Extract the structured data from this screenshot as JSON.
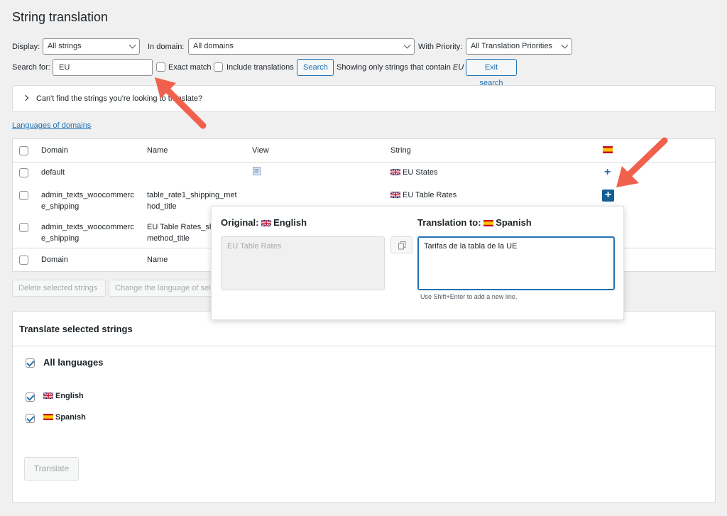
{
  "page": {
    "title": "String translation"
  },
  "filters": {
    "display_label": "Display:",
    "display_value": "All strings",
    "domain_label": "In domain:",
    "domain_value": "All domains",
    "priority_label": "With Priority:",
    "priority_value": "All Translation Priorities",
    "search_label": "Search for:",
    "search_value": "EU",
    "exact_match_label": "Exact match",
    "include_translations_label": "Include translations",
    "search_button": "Search",
    "showing_prefix": "Showing only strings that contain",
    "showing_term": "EU",
    "exit_search_button": "Exit search"
  },
  "notice": {
    "text": "Can't find the strings you're looking to translate?"
  },
  "languages_link": "Languages of domains",
  "table": {
    "headers": {
      "domain": "Domain",
      "name": "Name",
      "view": "View",
      "string": "String"
    },
    "rows": [
      {
        "domain": "default",
        "name": "",
        "string": "EU States"
      },
      {
        "domain_1": "admin_texts_woocommerc",
        "domain_2": "e_shipping",
        "name_1": "table_rate1_shipping_met",
        "name_2": "hod_title",
        "string": "EU Table Rates"
      },
      {
        "domain_1": "admin_texts_woocommerc",
        "domain_2": "e_shipping",
        "name_1": "EU Table Rates_sh",
        "name_2": "method_title"
      }
    ],
    "footer": {
      "domain": "Domain",
      "name": "Name"
    }
  },
  "bulk": {
    "delete_button": "Delete selected strings",
    "change_language_button": "Change the language of sele"
  },
  "popup": {
    "original_label": "Original:",
    "original_language": "English",
    "original_text": "EU Table Rates",
    "translation_label": "Translation to:",
    "translation_language": "Spanish",
    "translation_text": "Tarifas de la tabla de la UE",
    "hint": "Use Shift+Enter to add a new line."
  },
  "translate_section": {
    "title": "Translate selected strings",
    "all_languages": "All languages",
    "languages": [
      "English",
      "Spanish"
    ],
    "translate_button": "Translate"
  },
  "colors": {
    "accent": "#2271b1",
    "arrow": "#f0604d"
  }
}
